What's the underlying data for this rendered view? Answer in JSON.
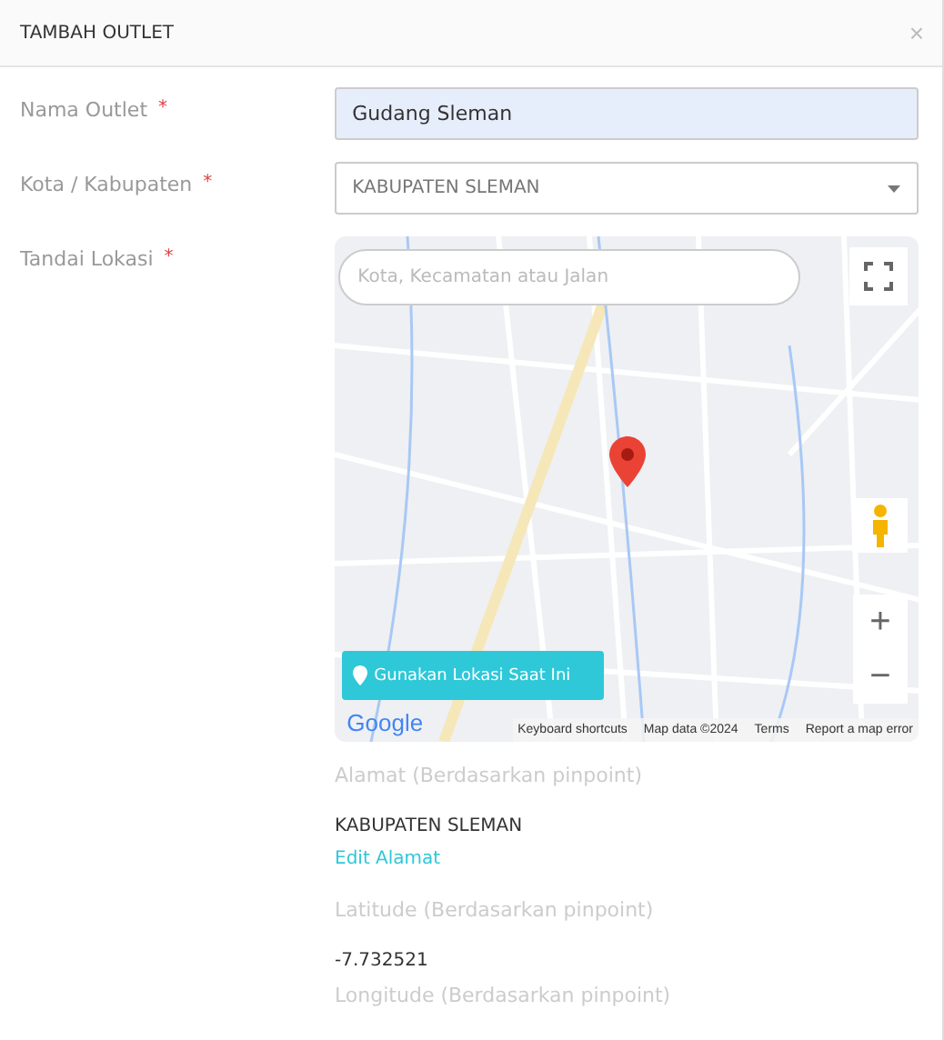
{
  "modal": {
    "title": "TAMBAH OUTLET",
    "close": "×"
  },
  "fields": [
    {
      "label": "Nama Outlet",
      "required": "*",
      "kind": "text",
      "value": "Gudang Sleman"
    },
    {
      "label": "Kota / Kabupaten",
      "required": "*",
      "kind": "select",
      "value": "KABUPATEN SLEMAN"
    },
    {
      "label": "Tandai Lokasi",
      "required": "*",
      "kind": "map"
    }
  ],
  "map": {
    "search_placeholder": "Kota, Kecamatan atau Jalan",
    "current_location_button": "Gunakan Lokasi Saat Ini",
    "zoom_in": "+",
    "zoom_out": "−",
    "logo": "Google",
    "attribution": [
      "Keyboard shortcuts",
      "Map data ©2024",
      "Terms",
      "Report a map error"
    ]
  },
  "details": [
    {
      "kind": "label",
      "text": "Alamat (Berdasarkan pinpoint)"
    },
    {
      "kind": "value",
      "text": "KABUPATEN SLEMAN"
    },
    {
      "kind": "link",
      "text": "Edit Alamat"
    },
    {
      "kind": "label",
      "text": "Latitude (Berdasarkan pinpoint)"
    },
    {
      "kind": "value",
      "text": "-7.732521"
    },
    {
      "kind": "label",
      "text": "Longitude (Berdasarkan pinpoint)"
    }
  ]
}
